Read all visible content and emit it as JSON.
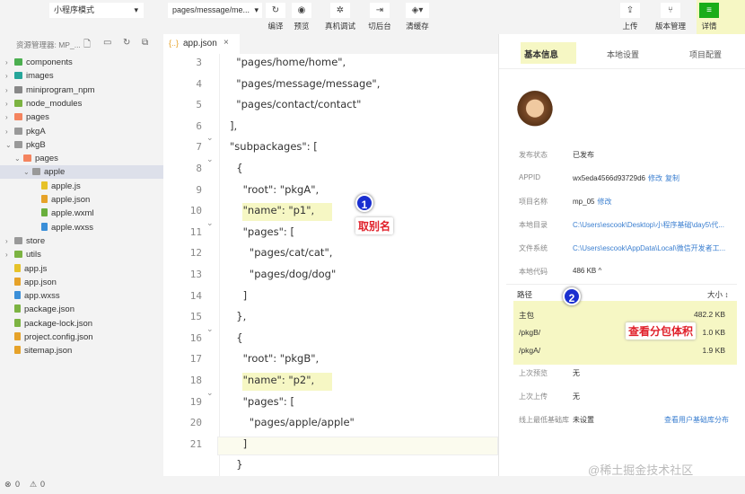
{
  "toolbar": {
    "mode": "小程序模式",
    "page_select": "pages/message/me...",
    "buttons": [
      {
        "label": "编译",
        "icon": "refresh-icon"
      },
      {
        "label": "预览",
        "icon": "eye-icon"
      },
      {
        "label": "真机调试",
        "icon": "bug-icon"
      },
      {
        "label": "切后台",
        "icon": "switch-icon"
      },
      {
        "label": "清缓存",
        "icon": "layers-icon"
      }
    ],
    "right_buttons": [
      {
        "label": "上传",
        "icon": "upload-icon"
      },
      {
        "label": "版本管理",
        "icon": "branch-icon"
      },
      {
        "label": "详情",
        "icon": "menu-icon"
      }
    ],
    "accent": "#1aad19"
  },
  "explorer": {
    "title": "资源管理器: MP_...",
    "items": [
      {
        "label": "components",
        "depth": 1,
        "type": "folder",
        "color": "#4caf50"
      },
      {
        "label": "images",
        "depth": 1,
        "type": "folder",
        "color": "#26a69a"
      },
      {
        "label": "miniprogram_npm",
        "depth": 1,
        "type": "folder",
        "color": "#888"
      },
      {
        "label": "node_modules",
        "depth": 1,
        "type": "folder",
        "color": "#7cb342"
      },
      {
        "label": "pages",
        "depth": 1,
        "type": "folder",
        "color": "#f4845f"
      },
      {
        "label": "pkgA",
        "depth": 1,
        "type": "folder",
        "color": "#999"
      },
      {
        "label": "pkgB",
        "depth": 1,
        "type": "folder",
        "color": "#999",
        "open": true
      },
      {
        "label": "pages",
        "depth": 2,
        "type": "folder",
        "color": "#f4845f",
        "open": true
      },
      {
        "label": "apple",
        "depth": 3,
        "type": "folder",
        "color": "#999",
        "open": true,
        "selected": true
      },
      {
        "label": "apple.js",
        "depth": 4,
        "type": "file",
        "color": "#e6c229"
      },
      {
        "label": "apple.json",
        "depth": 4,
        "type": "file",
        "color": "#e6a229"
      },
      {
        "label": "apple.wxml",
        "depth": 4,
        "type": "file",
        "color": "#6aaf3d"
      },
      {
        "label": "apple.wxss",
        "depth": 4,
        "type": "file",
        "color": "#3b8fd8"
      },
      {
        "label": "store",
        "depth": 1,
        "type": "folder",
        "color": "#999"
      },
      {
        "label": "utils",
        "depth": 1,
        "type": "folder",
        "color": "#7cb342"
      },
      {
        "label": "app.js",
        "depth": 1,
        "type": "file",
        "color": "#e6c229"
      },
      {
        "label": "app.json",
        "depth": 1,
        "type": "file",
        "color": "#e6a229"
      },
      {
        "label": "app.wxss",
        "depth": 1,
        "type": "file",
        "color": "#3b8fd8"
      },
      {
        "label": "package.json",
        "depth": 1,
        "type": "file",
        "color": "#7cb342"
      },
      {
        "label": "package-lock.json",
        "depth": 1,
        "type": "file",
        "color": "#7cb342"
      },
      {
        "label": "project.config.json",
        "depth": 1,
        "type": "file",
        "color": "#e6a229"
      },
      {
        "label": "sitemap.json",
        "depth": 1,
        "type": "file",
        "color": "#e6a229"
      }
    ]
  },
  "editor": {
    "tab": "app.json",
    "lines": [
      {
        "n": "3",
        "text": "  \"pages/home/home\","
      },
      {
        "n": "4",
        "text": "  \"pages/message/message\","
      },
      {
        "n": "5",
        "text": "  \"pages/contact/contact\""
      },
      {
        "n": "6",
        "text": "],"
      },
      {
        "n": "7",
        "text": "\"subpackages\": [",
        "fold": true
      },
      {
        "n": "8",
        "text": "  {",
        "fold": true
      },
      {
        "n": "9",
        "text": "    \"root\": \"pkgA\","
      },
      {
        "n": "10",
        "text": "    \"name\": \"p1\",",
        "hl": true
      },
      {
        "n": "11",
        "text": "    \"pages\": [",
        "fold": true
      },
      {
        "n": "12",
        "text": "      \"pages/cat/cat\","
      },
      {
        "n": "13",
        "text": "      \"pages/dog/dog\""
      },
      {
        "n": "14",
        "text": "    ]"
      },
      {
        "n": "15",
        "text": "  },"
      },
      {
        "n": "16",
        "text": "  {",
        "fold": true
      },
      {
        "n": "17",
        "text": "    \"root\": \"pkgB\","
      },
      {
        "n": "18",
        "text": "    \"name\": \"p2\",",
        "hl": true
      },
      {
        "n": "19",
        "text": "    \"pages\": [",
        "fold": true
      },
      {
        "n": "20",
        "text": "      \"pages/apple/apple\""
      },
      {
        "n": "21",
        "text": "    ]",
        "cursor": true
      },
      {
        "n": "",
        "text": "  }"
      }
    ]
  },
  "details": {
    "tabs": [
      "基本信息",
      "本地设置",
      "项目配置"
    ],
    "active_tab": "基本信息",
    "rows": [
      {
        "label": "发布状态",
        "value": "已发布"
      },
      {
        "label": "APPID",
        "value": "wx5eda4566d93729d6",
        "links": [
          "修改",
          "复制"
        ]
      },
      {
        "label": "项目名称",
        "value": "mp_05",
        "links": [
          "修改"
        ]
      },
      {
        "label": "本地目录",
        "value": "C:\\Users\\escook\\Desktop\\小程序基础\\day5\\代...",
        "link": true
      },
      {
        "label": "文件系统",
        "value": "C:\\Users\\escook\\AppData\\Local\\微信开发者工...",
        "link": true
      },
      {
        "label": "本地代码",
        "value": "486 KB ^"
      }
    ],
    "size_table": {
      "header_path": "路径",
      "header_size": "大小 ↕",
      "rows": [
        {
          "path": "主包",
          "size": "482.2 KB"
        },
        {
          "path": "/pkgB/",
          "size": "1.0 KB"
        },
        {
          "path": "/pkgA/",
          "size": "1.9 KB"
        }
      ]
    },
    "rows2": [
      {
        "label": "上次预览",
        "value": "无"
      },
      {
        "label": "上次上传",
        "value": "无"
      },
      {
        "label": "线上最低基础库",
        "value": "未设置",
        "link": "查看用户基础库分布"
      }
    ]
  },
  "annotations": [
    {
      "num": "1",
      "text": "取别名"
    },
    {
      "num": "2",
      "text": "查看分包体积"
    }
  ],
  "status": {
    "errors": "0",
    "warnings": "0"
  },
  "watermark": "@稀土掘金技术社区"
}
